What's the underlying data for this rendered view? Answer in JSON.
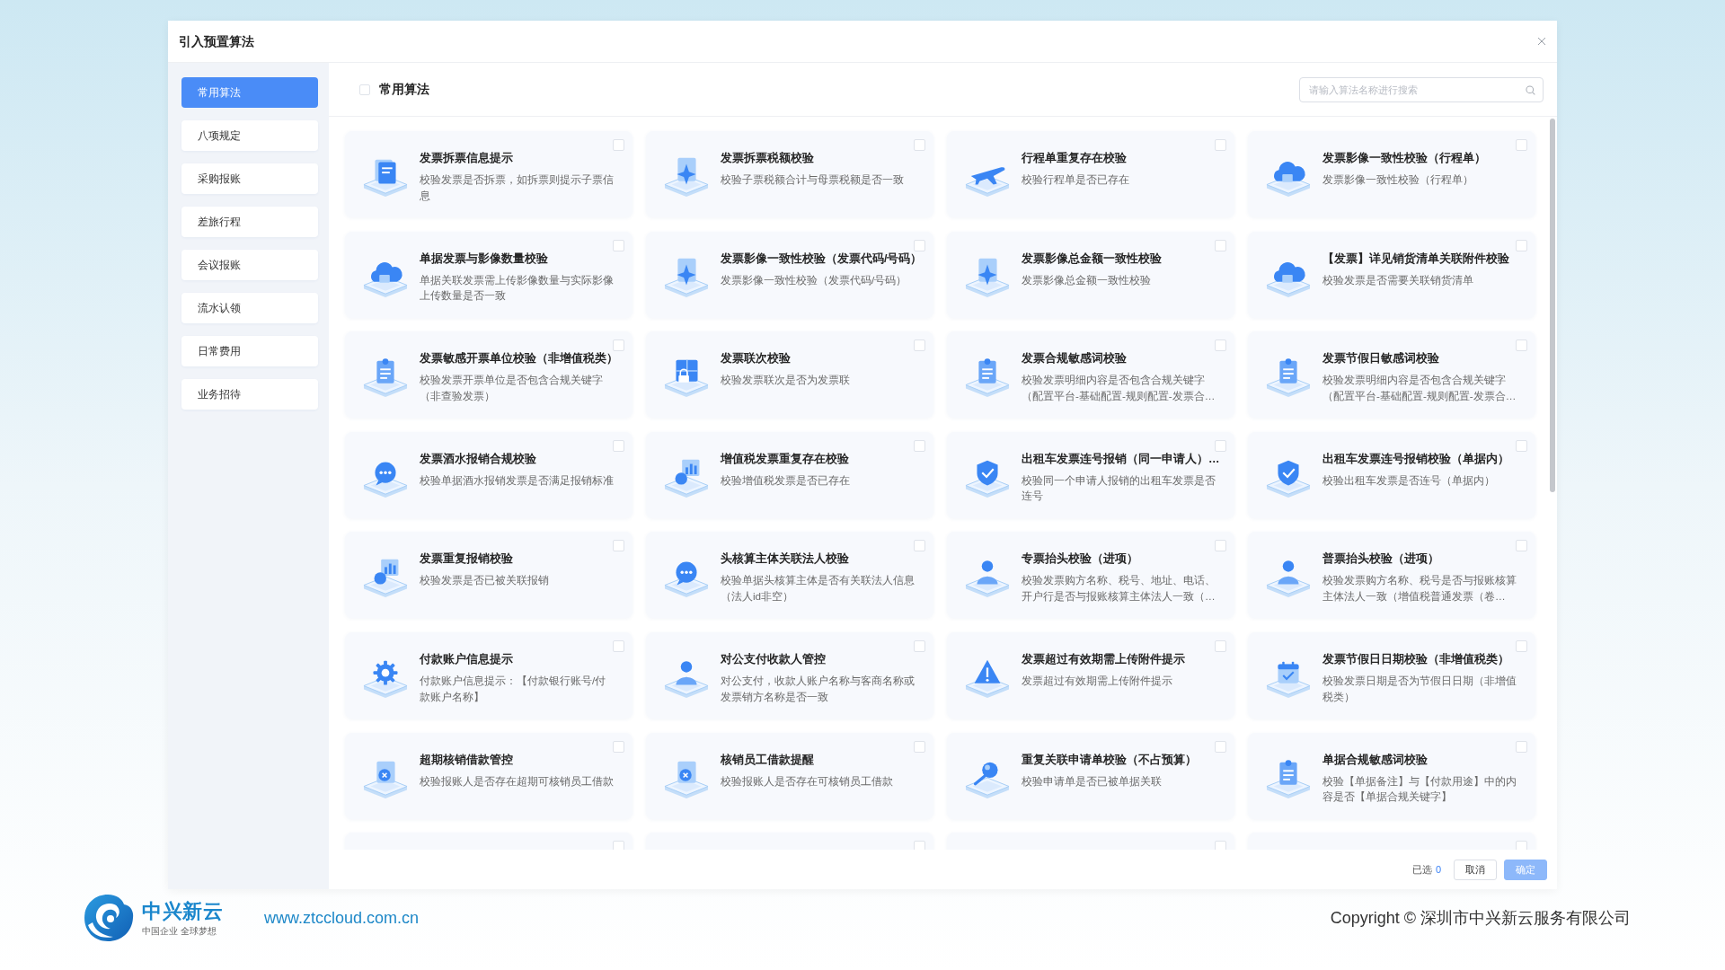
{
  "dialog": {
    "title": "引入预置算法"
  },
  "sidebar": {
    "items": [
      {
        "label": "常用算法",
        "selected": true
      },
      {
        "label": "八项规定",
        "selected": false
      },
      {
        "label": "采购报账",
        "selected": false
      },
      {
        "label": "差旅行程",
        "selected": false
      },
      {
        "label": "会议报账",
        "selected": false
      },
      {
        "label": "流水认领",
        "selected": false
      },
      {
        "label": "日常费用",
        "selected": false
      },
      {
        "label": "业务招待",
        "selected": false
      }
    ]
  },
  "toolbar": {
    "select_all": {
      "checked": false
    },
    "title": "常用算法",
    "search": {
      "placeholder": "请输入算法名称进行搜索"
    }
  },
  "cards": [
    {
      "title": "发票拆票信息提示",
      "description": "校验发票是否拆票，如拆票则提示子票信息",
      "checked": false
    },
    {
      "title": "发票拆票税额校验",
      "description": "校验子票税额合计与母票税额是否一致",
      "checked": false
    },
    {
      "title": "行程单重复存在校验",
      "description": "校验行程单是否已存在",
      "checked": false
    },
    {
      "title": "发票影像一致性校验（行程单）",
      "description": "发票影像一致性校验（行程单）",
      "checked": false
    },
    {
      "title": "单据发票与影像数量校验",
      "description": "单据关联发票需上传影像数量与实际影像上传数量是否一致",
      "checked": false
    },
    {
      "title": "发票影像一致性校验（发票代码/号码）",
      "description": "发票影像一致性校验（发票代码/号码）",
      "checked": false
    },
    {
      "title": "发票影像总金额一致性校验",
      "description": "发票影像总金额一致性校验",
      "checked": false
    },
    {
      "title": "【发票】详见销货清单关联附件校验",
      "description": "校验发票是否需要关联销货清单",
      "checked": false
    },
    {
      "title": "发票敏感开票单位校验（非增值税类）",
      "description": "校验发票开票单位是否包含合规关键字（非查验发票）",
      "checked": false
    },
    {
      "title": "发票联次校验",
      "description": "校验发票联次是否为发票联",
      "checked": false
    },
    {
      "title": "发票合规敏感词校验",
      "description": "校验发票明细内容是否包含合规关键字（配置平台-基础配置-规则配置-发票合…",
      "checked": false
    },
    {
      "title": "发票节假日敏感词校验",
      "description": "校验发票明细内容是否包含合规关键字（配置平台-基础配置-规则配置-发票合…",
      "checked": false
    },
    {
      "title": "发票酒水报销合规校验",
      "description": "校验单据酒水报销发票是否满足报销标准",
      "checked": false
    },
    {
      "title": "增值税发票重复存在校验",
      "description": "校验增值税发票是否已存在",
      "checked": false
    },
    {
      "title": "出租车发票连号报销（同一申请人）…",
      "description": "校验同一个申请人报销的出租车发票是否连号",
      "checked": false
    },
    {
      "title": "出租车发票连号报销校验（单据内）",
      "description": "校验出租车发票是否连号（单据内）",
      "checked": false
    },
    {
      "title": "发票重复报销校验",
      "description": "校验发票是否已被关联报销",
      "checked": false
    },
    {
      "title": "头核算主体关联法人校验",
      "description": "校验单据头核算主体是否有关联法人信息（法人id非空）",
      "checked": false
    },
    {
      "title": "专票抬头校验（进项）",
      "description": "校验发票购方名称、税号、地址、电话、开户行是否与报账核算主体法人一致（…",
      "checked": false
    },
    {
      "title": "普票抬头校验（进项）",
      "description": "校验发票购方名称、税号是否与报账核算主体法人一致（增值税普通发票（卷…",
      "checked": false
    },
    {
      "title": "付款账户信息提示",
      "description": "付款账户信息提示：【付款银行账号/付款账户名称】",
      "checked": false
    },
    {
      "title": "对公支付收款人管控",
      "description": "对公支付，收款人账户名称与客商名称或发票销方名称是否一致",
      "checked": false
    },
    {
      "title": "发票超过有效期需上传附件提示",
      "description": "发票超过有效期需上传附件提示",
      "checked": false
    },
    {
      "title": "发票节假日日期校验（非增值税类）",
      "description": "校验发票日期是否为节假日日期（非增值税类）",
      "checked": false
    },
    {
      "title": "超期核销借款管控",
      "description": "校验报账人是否存在超期可核销员工借款",
      "checked": false
    },
    {
      "title": "核销员工借款提醒",
      "description": "校验报账人是否存在可核销员工借款",
      "checked": false
    },
    {
      "title": "重复关联申请单校验（不占预算）",
      "description": "校验申请单是否已被单据关联",
      "checked": false
    },
    {
      "title": "单据合规敏感词校验",
      "description": "校验【单据备注】与【付款用途】中的内容是否【单据合规关键字】",
      "checked": false
    },
    {
      "checked": false
    },
    {
      "checked": false
    },
    {
      "checked": false
    },
    {
      "checked": false
    }
  ],
  "footer_bar": {
    "selected_label": "已选",
    "selected_count": "0",
    "buttons": [
      {
        "label": "取消",
        "kind": "secondary",
        "disabled": false
      },
      {
        "label": "确定",
        "kind": "primary",
        "disabled": true
      }
    ]
  },
  "page_footer": {
    "logo": {
      "name": "中兴新云",
      "slogan": "中国企业 全球梦想"
    },
    "website": "www.ztccloud.com.cn",
    "copyright": "Copyright © 深圳市中兴新云服务有限公司"
  }
}
